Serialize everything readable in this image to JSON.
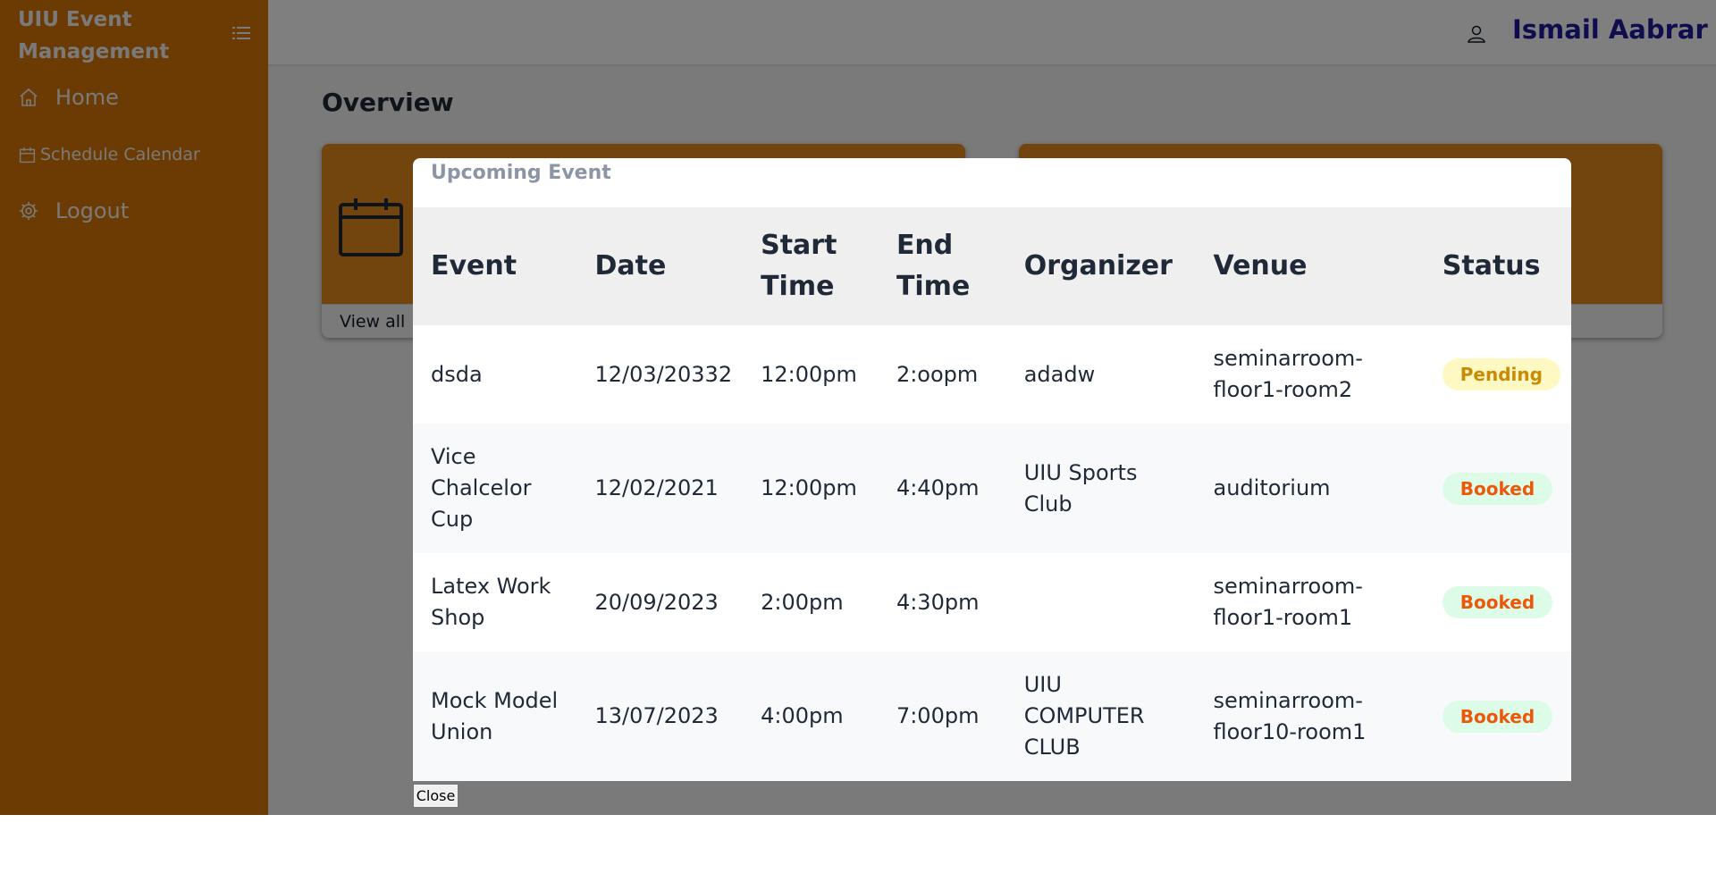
{
  "sidebar": {
    "brand": "UIU Event Management",
    "items": [
      {
        "label": "Home",
        "icon": "home-icon"
      },
      {
        "label": "Schedule Calendar",
        "icon": "calendar-icon"
      },
      {
        "label": "Logout",
        "icon": "gear-icon"
      }
    ]
  },
  "header": {
    "user_name": "Ismail Aabrar",
    "user_icon": "user-icon"
  },
  "main": {
    "title": "Overview",
    "cards": [
      {
        "footer": "View all",
        "icon": "calendar-icon"
      }
    ]
  },
  "modal": {
    "title": "Upcoming Event",
    "columns": [
      "Event",
      "Date",
      "Start Time",
      "End Time",
      "Organizer",
      "Venue",
      "Status"
    ],
    "rows": [
      {
        "event": "dsda",
        "date": "12/03/20332",
        "start": "12:00pm",
        "end": "2:oopm",
        "organizer": "adadw",
        "venue": "seminarroom-floor1-room2",
        "status": "Pending"
      },
      {
        "event": "Vice Chalcelor Cup",
        "date": "12/02/2021",
        "start": "12:00pm",
        "end": "4:40pm",
        "organizer": "UIU Sports Club",
        "venue": "auditorium",
        "status": "Booked"
      },
      {
        "event": "Latex Work Shop",
        "date": "20/09/2023",
        "start": "2:00pm",
        "end": "4:30pm",
        "organizer": "",
        "venue": "seminarroom-floor1-room1",
        "status": "Booked"
      },
      {
        "event": "Mock Model Union",
        "date": "13/07/2023",
        "start": "4:00pm",
        "end": "7:00pm",
        "organizer": "UIU COMPUTER CLUB",
        "venue": "seminarroom-floor10-room1",
        "status": "Booked"
      }
    ],
    "close_label": "Close"
  },
  "colors": {
    "sidebar": "#d97706",
    "card": "#e58a1f",
    "user_name": "#1e1b9b",
    "pending_bg": "#fef9c3",
    "booked_bg": "#dcfce7"
  }
}
